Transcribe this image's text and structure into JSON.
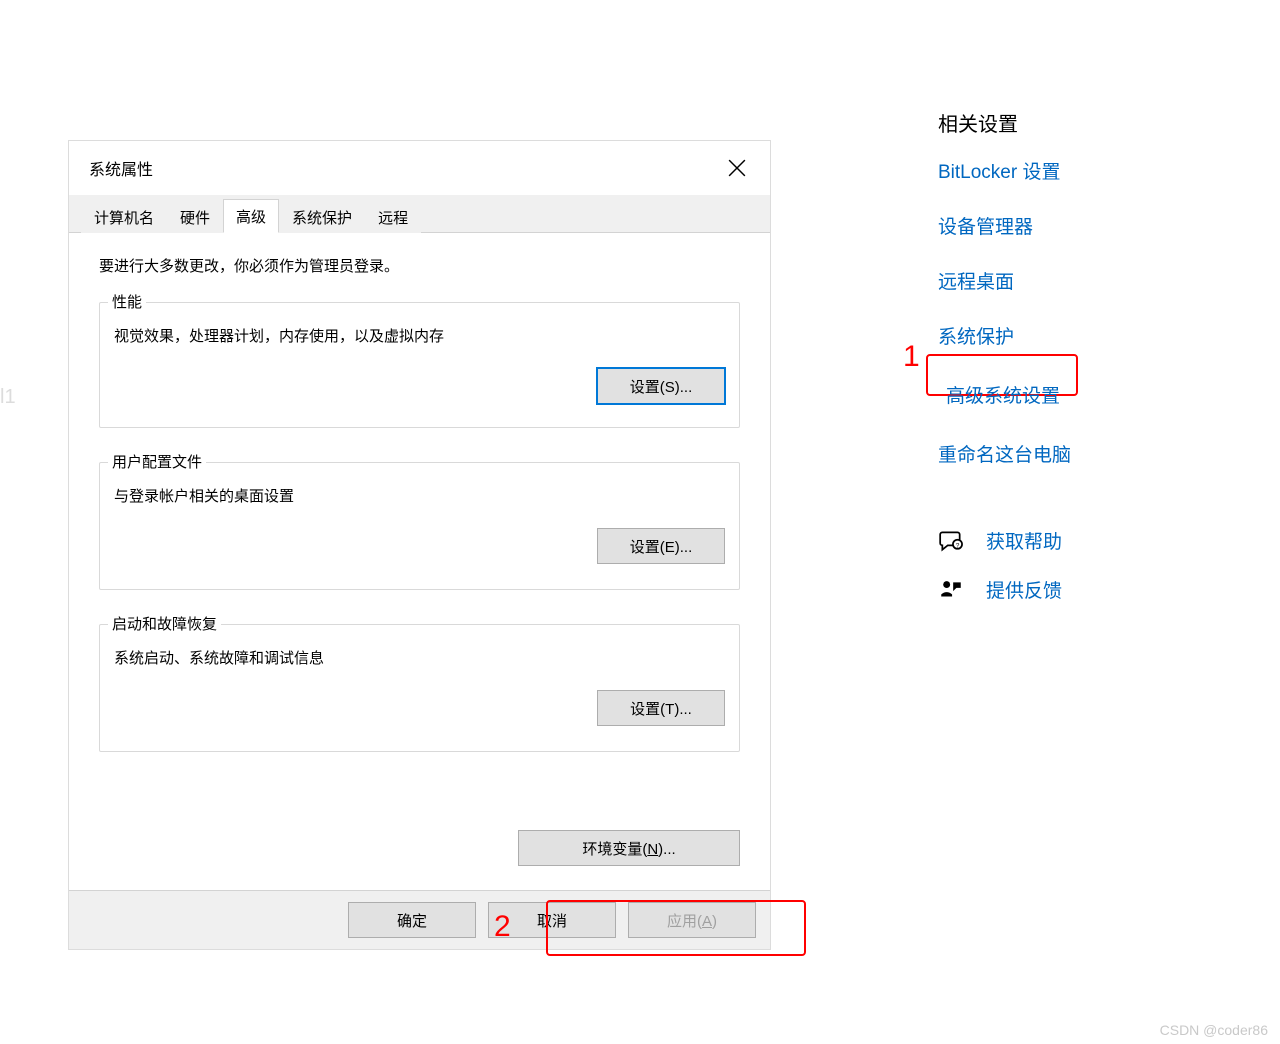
{
  "left_mark": "l1",
  "dialog": {
    "title": "系统属性",
    "tabs": [
      "计算机名",
      "硬件",
      "高级",
      "系统保护",
      "远程"
    ],
    "active_tab_index": 2,
    "admin_note": "要进行大多数更改，你必须作为管理员登录。",
    "groups": {
      "performance": {
        "legend": "性能",
        "desc": "视觉效果，处理器计划，内存使用，以及虚拟内存",
        "button": "设置(S)..."
      },
      "user_profiles": {
        "legend": "用户配置文件",
        "desc": "与登录帐户相关的桌面设置",
        "button": "设置(E)..."
      },
      "startup": {
        "legend": "启动和故障恢复",
        "desc": "系统启动、系统故障和调试信息",
        "button": "设置(T)..."
      }
    },
    "env_button_prefix": "环境变量(",
    "env_button_letter": "N",
    "env_button_suffix": ")...",
    "footer": {
      "ok": "确定",
      "cancel": "取消",
      "apply_prefix": "应用(",
      "apply_letter": "A",
      "apply_suffix": ")"
    }
  },
  "annotations": {
    "n1": "1",
    "n2": "2"
  },
  "related": {
    "title": "相关设置",
    "links": [
      "BitLocker 设置",
      "设备管理器",
      "远程桌面",
      "系统保护",
      "高级系统设置",
      "重命名这台电脑"
    ],
    "help": "获取帮助",
    "feedback": "提供反馈"
  },
  "watermark": "CSDN @coder86"
}
